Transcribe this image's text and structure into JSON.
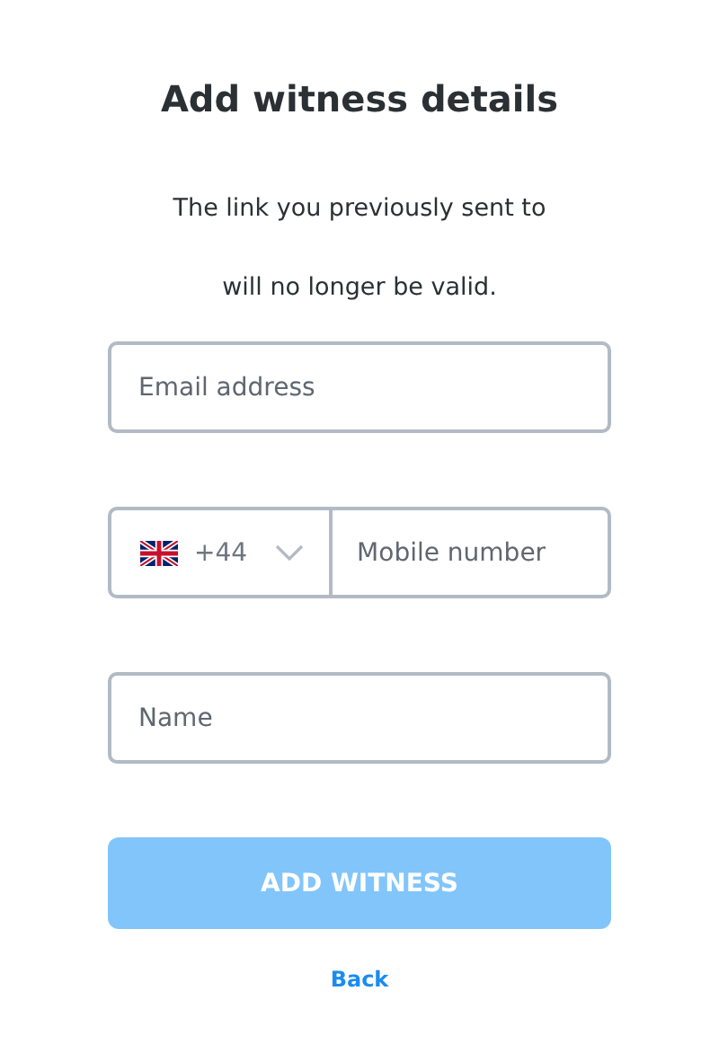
{
  "title": "Add witness details",
  "message_lines": [
    "The link you previously sent to",
    "will no longer be valid."
  ],
  "email": {
    "placeholder": "Email address"
  },
  "phone": {
    "country_code": "+44",
    "placeholder": "Mobile number"
  },
  "name": {
    "placeholder": "Name"
  },
  "submit": {
    "label": "ADD WITNESS",
    "disabled": true
  },
  "back": {
    "label": "Back"
  }
}
